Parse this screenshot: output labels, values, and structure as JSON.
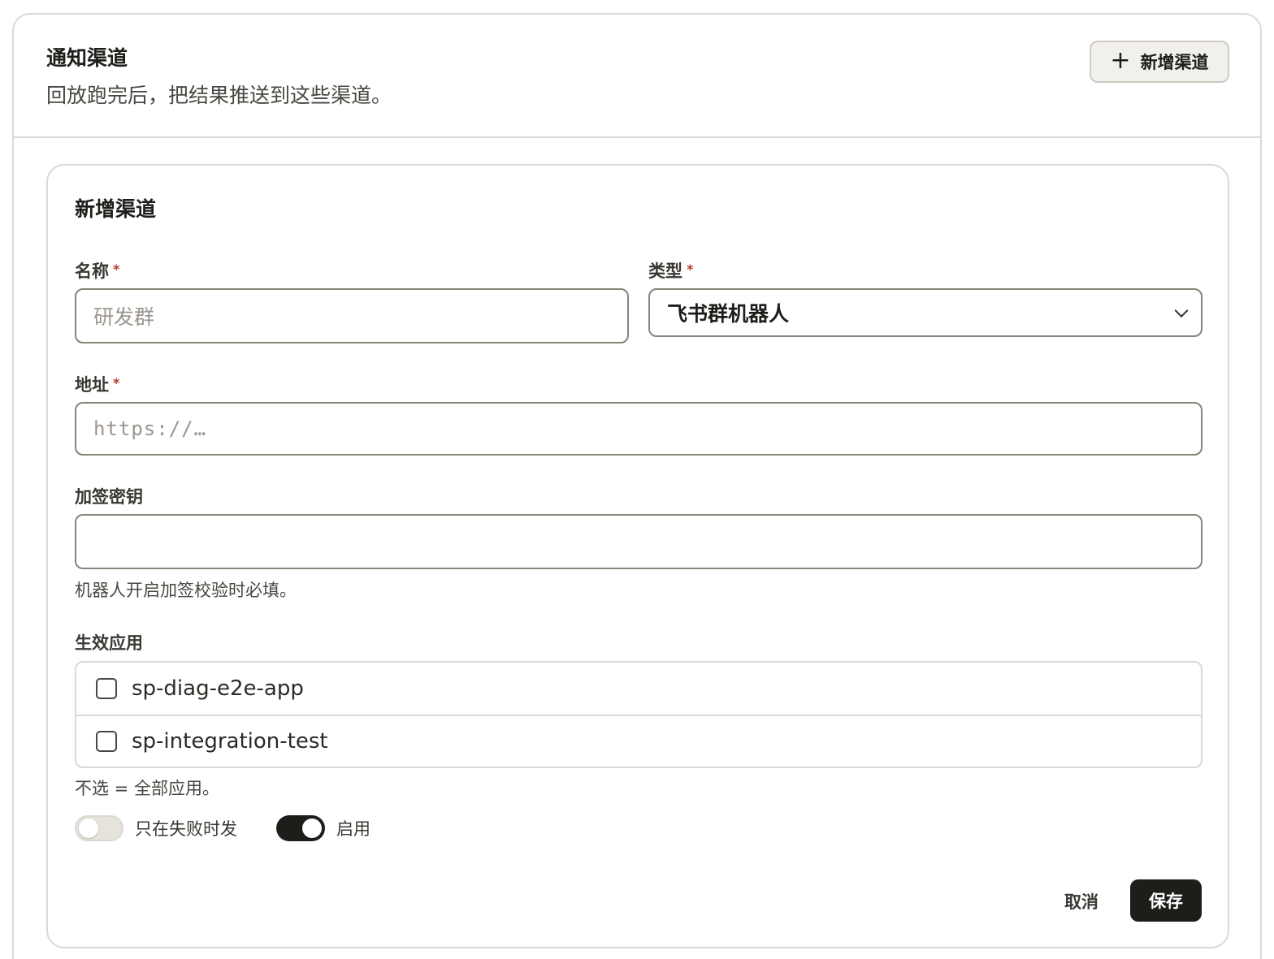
{
  "header": {
    "title": "通知渠道",
    "description": "回放跑完后，把结果推送到这些渠道。",
    "add_button_label": "新增渠道"
  },
  "form": {
    "title": "新增渠道",
    "name": {
      "label": "名称",
      "required_mark": "*",
      "placeholder": "研发群",
      "value": ""
    },
    "type": {
      "label": "类型",
      "required_mark": "*",
      "selected": "飞书群机器人"
    },
    "address": {
      "label": "地址",
      "required_mark": "*",
      "placeholder": "https://…",
      "value": ""
    },
    "secret": {
      "label": "加签密钥",
      "value": "",
      "hint": "机器人开启加签校验时必填。"
    },
    "apps": {
      "label": "生效应用",
      "items": [
        {
          "name": "sp-diag-e2e-app",
          "checked": false
        },
        {
          "name": "sp-integration-test",
          "checked": false
        }
      ],
      "hint": "不选 = 全部应用。"
    },
    "toggles": {
      "failure_only": {
        "label": "只在失败时发",
        "on": false
      },
      "enabled": {
        "label": "启用",
        "on": true
      }
    },
    "cancel_label": "取消",
    "save_label": "保存"
  }
}
